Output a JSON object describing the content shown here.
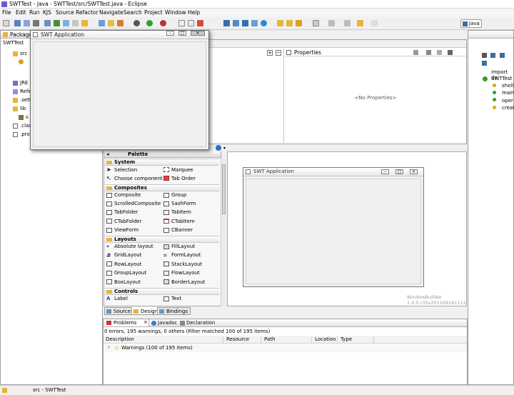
{
  "window": {
    "title": "SWTTest - Java - SWTTest/src/SWTTest.java - Eclipse"
  },
  "menu": [
    "File",
    "Edit",
    "Run",
    "KJS",
    "Source",
    "Refactor",
    "Navigate",
    "Search",
    "Project",
    "Window",
    "Help"
  ],
  "perspective": {
    "label": "Java"
  },
  "package_explorer": {
    "tab_label": "Package",
    "project": "SWTTest",
    "items": [
      "src",
      "JRE S",
      "Refer",
      ".setti",
      "lib",
      "s",
      ".class",
      ".proj"
    ]
  },
  "floating_window": {
    "title": "SWT Application"
  },
  "properties": {
    "tab_label": "Properties",
    "empty_text": "<No Properties>"
  },
  "palette": {
    "header": "Palette",
    "categories": {
      "system": "System",
      "composites": "Composites",
      "layouts": "Layouts",
      "controls": "Controls"
    },
    "system_items": [
      "Selection",
      "Marquee",
      "Choose component",
      "Tab Order"
    ],
    "composite_items": [
      "Composite",
      "Group",
      "ScrolledComposite",
      "SashForm",
      "TabFolder",
      "TabItem",
      "CTabFolder",
      "CTabItem",
      "ViewForm",
      "CBanner"
    ],
    "layout_items": [
      "Absolute layout",
      "FillLayout",
      "GridLayout",
      "FormLayout",
      "RowLayout",
      "StackLayout",
      "GroupLayout",
      "FlowLayout",
      "BoxLayout",
      "BorderLayout"
    ],
    "control_items": [
      "Label",
      "Text"
    ]
  },
  "design_canvas": {
    "window_title": "SWT Application",
    "watermark_line1": "WindowBuilder",
    "watermark_line2": "1.0.0.r35x201106161111"
  },
  "editor_tabs": [
    "Source",
    "Design",
    "Bindings"
  ],
  "problems": {
    "tabs": [
      "Problems",
      "Javadoc",
      "Declaration"
    ],
    "summary": "0 errors, 195 warnings, 0 others (Filter matched 100 of 195 items)",
    "columns": [
      "Description",
      "Resource",
      "Path",
      "Location",
      "Type"
    ],
    "row": "Warnings (100 of 195 items)"
  },
  "outline": {
    "items": [
      "import de",
      "SWTTest",
      "shell",
      "main",
      "oper",
      "creat"
    ]
  },
  "status": {
    "text": "src - SWTTest"
  },
  "colors": {
    "accent": "#3a6ea5",
    "warning": "#e0a800",
    "folder": "#e6b53a"
  }
}
